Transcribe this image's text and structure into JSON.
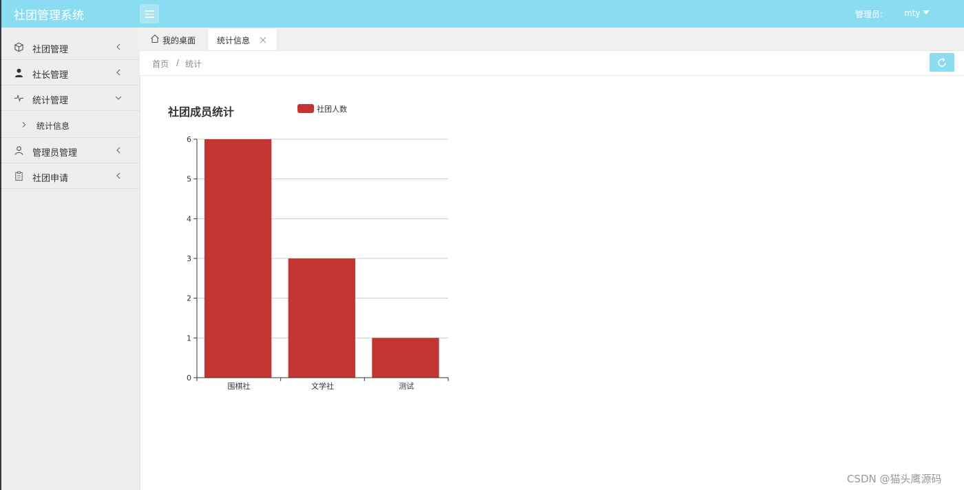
{
  "header": {
    "logo": "社团管理系统",
    "admin_label": "管理员:",
    "admin_user": "mty"
  },
  "sidebar": {
    "items": [
      {
        "label": "社团管理",
        "icon": "cube-icon"
      },
      {
        "label": "社长管理",
        "icon": "user-icon"
      },
      {
        "label": "统计管理",
        "icon": "pulse-icon",
        "expanded": true
      },
      {
        "label": "管理员管理",
        "icon": "user-outline-icon"
      },
      {
        "label": "社团申请",
        "icon": "clipboard-icon"
      }
    ],
    "sub_items": [
      {
        "label": "统计信息"
      }
    ]
  },
  "tabs": [
    {
      "label": "我的桌面",
      "icon": "home-icon"
    },
    {
      "label": "统计信息",
      "active": true
    }
  ],
  "breadcrumb": {
    "home": "首页",
    "separator": "/",
    "current": "统计"
  },
  "colors": {
    "header": "#8adcf1",
    "bar": "#c23531",
    "sidebar": "#eeeeee"
  },
  "chart_data": {
    "type": "bar",
    "title": "社团成员统计",
    "categories": [
      "围棋社",
      "文学社",
      "测试"
    ],
    "series": [
      {
        "name": "社团人数",
        "values": [
          6,
          3,
          1
        ]
      }
    ],
    "ylim": [
      0,
      6
    ],
    "yticks": [
      0,
      1,
      2,
      3,
      4,
      5,
      6
    ],
    "grid": true,
    "legend": "top"
  },
  "watermark": "CSDN @猫头鹰源码"
}
